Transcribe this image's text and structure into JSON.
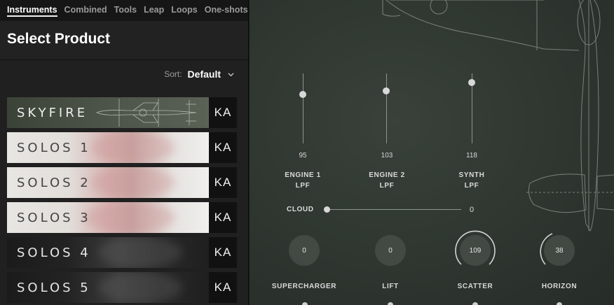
{
  "tabs": [
    "Instruments",
    "Combined",
    "Tools",
    "Leap",
    "Loops",
    "One-shots"
  ],
  "title": "Select Product",
  "sort": {
    "label": "Sort:",
    "value": "Default"
  },
  "products": [
    {
      "name": "SKYFIRE",
      "badge": "KA"
    },
    {
      "name": "SOLOS 1",
      "badge": "KA"
    },
    {
      "name": "SOLOS 2",
      "badge": "KA"
    },
    {
      "name": "SOLOS 3",
      "badge": "KA"
    },
    {
      "name": "SOLOS 4",
      "badge": "KA"
    },
    {
      "name": "SOLOS 5",
      "badge": "KA"
    }
  ],
  "faders": [
    {
      "name": "ENGINE 1",
      "sub": "LPF",
      "value": "95"
    },
    {
      "name": "ENGINE 2",
      "sub": "LPF",
      "value": "103"
    },
    {
      "name": "SYNTH",
      "sub": "LPF",
      "value": "118"
    }
  ],
  "cloud": {
    "label": "CLOUD",
    "value": "0"
  },
  "knobs": [
    {
      "name": "SUPERCHARGER",
      "value": "0"
    },
    {
      "name": "LIFT",
      "value": "0"
    },
    {
      "name": "SCATTER",
      "value": "109"
    },
    {
      "name": "HORIZON",
      "value": "38"
    }
  ],
  "colors": {
    "panel": "#202020",
    "tab_bar": "#161616",
    "instrument_bg": "#2f3630",
    "accent": "#ffffff"
  }
}
